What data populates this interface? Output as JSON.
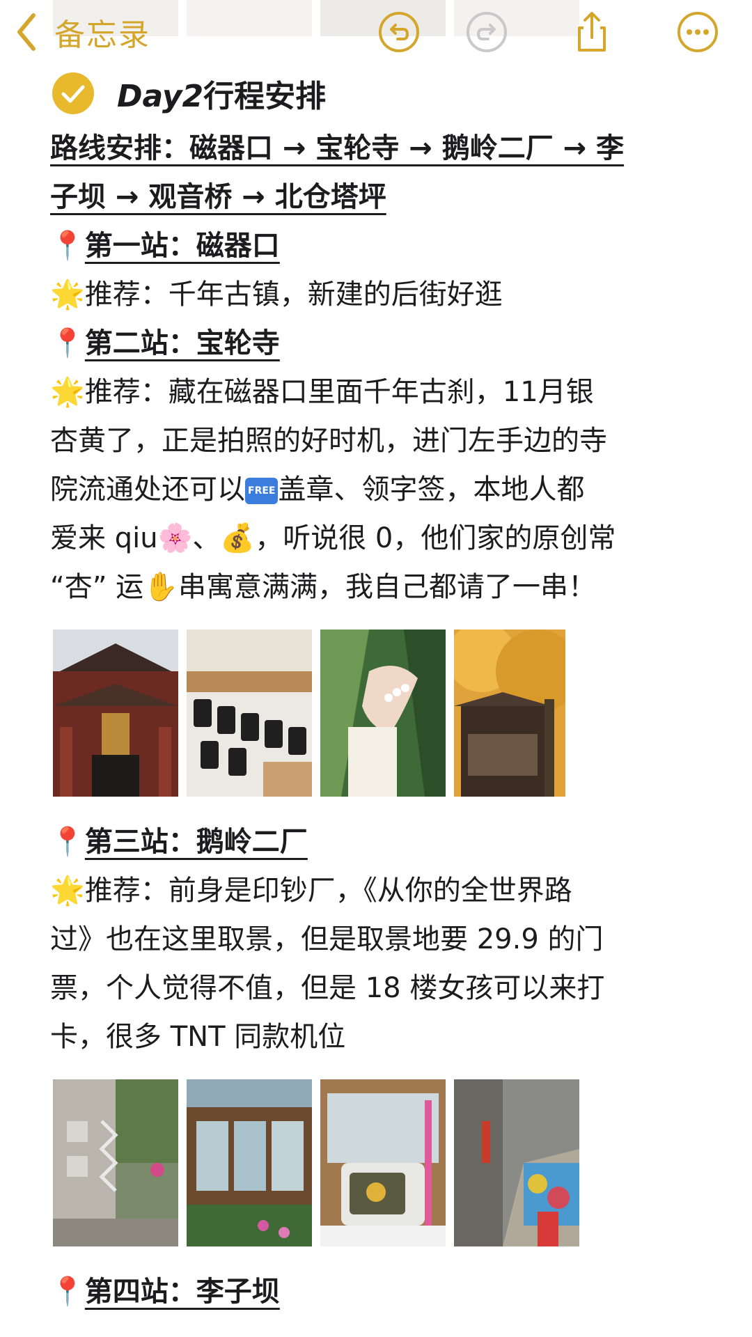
{
  "nav": {
    "back_label": "备忘录"
  },
  "note": {
    "heading_day": "Day2",
    "heading_rest": "行程安排",
    "route_line1": "路线安排：磁器口 → 宝轮寺 → 鹅岭二厂 → 李",
    "route_line2": "子坝 → 观音桥 → 北仓塔坪",
    "stations": [
      {
        "title": "第一站：磁器口",
        "lines": [
          "推荐：千年古镇，新建的后街好逛"
        ]
      },
      {
        "title": "第二站：宝轮寺",
        "lines": [
          "推荐：藏在磁器口里面千年古刹，11月银",
          "杏黄了，正是拍照的好时机，进门左手边的寺",
          "院流通处还可以",
          "盖章、领字签，本地人都",
          "爱来 qiu",
          "、",
          "，听说很 0，他们家的原创常",
          "“杏” 运",
          "串寓意满满，我自己都请了一串！"
        ]
      },
      {
        "title": "第三站：鹅岭二厂",
        "lines": [
          "推荐：前身是印钞厂，《从你的全世界路",
          "过》也在这里取景，但是取景地要 29.9 的门",
          "票，个人觉得不值，但是 18 楼女孩可以来打",
          "卡，很多 TNT 同款机位"
        ]
      },
      {
        "title": "第四站：李子坝"
      }
    ],
    "free_badge": "FREE"
  }
}
